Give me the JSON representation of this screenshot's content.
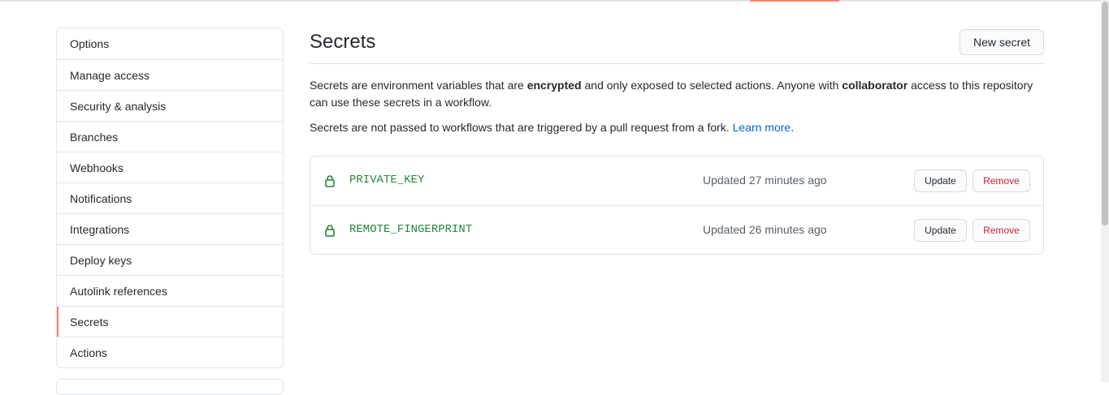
{
  "sidebar": {
    "items": [
      {
        "label": "Options"
      },
      {
        "label": "Manage access"
      },
      {
        "label": "Security & analysis"
      },
      {
        "label": "Branches"
      },
      {
        "label": "Webhooks"
      },
      {
        "label": "Notifications"
      },
      {
        "label": "Integrations"
      },
      {
        "label": "Deploy keys"
      },
      {
        "label": "Autolink references"
      },
      {
        "label": "Secrets"
      },
      {
        "label": "Actions"
      }
    ],
    "active": "Secrets"
  },
  "main": {
    "title": "Secrets",
    "new_secret_label": "New secret",
    "description": {
      "p1_a": "Secrets are environment variables that are ",
      "p1_b": "encrypted",
      "p1_c": " and only exposed to selected actions. Anyone with ",
      "p1_d": "collaborator",
      "p1_e": " access to this repository can use these secrets in a workflow.",
      "p2_a": "Secrets are not passed to workflows that are triggered by a pull request from a fork. ",
      "p2_link": "Learn more",
      "p2_end": "."
    },
    "secrets": [
      {
        "name": "PRIVATE_KEY",
        "updated": "Updated 27 minutes ago",
        "update_label": "Update",
        "remove_label": "Remove"
      },
      {
        "name": "REMOTE_FINGERPRINT",
        "updated": "Updated 26 minutes ago",
        "update_label": "Update",
        "remove_label": "Remove"
      }
    ]
  },
  "colors": {
    "accent": "#f9826c",
    "link": "#0366d6",
    "secret_name": "#22863a",
    "danger": "#cb2431"
  },
  "icons": {
    "lock": "lock-icon"
  }
}
